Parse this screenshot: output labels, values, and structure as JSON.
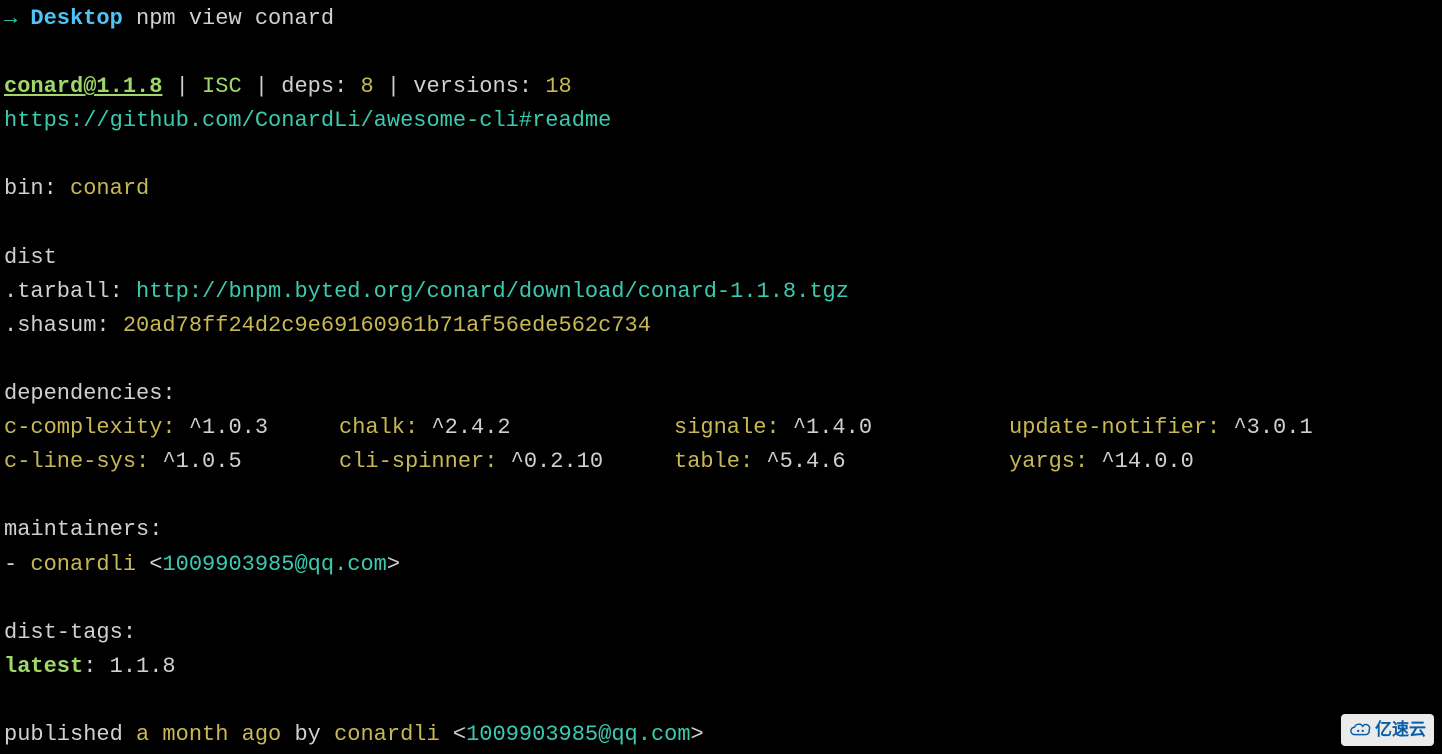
{
  "prompt": {
    "arrow": "→",
    "location": "Desktop",
    "command": "npm view conard"
  },
  "package": {
    "name": "conard",
    "at": "@",
    "version": "1.1.8",
    "license": "ISC",
    "deps_label": "deps:",
    "deps_count": "8",
    "versions_label": "versions:",
    "versions_count": "18",
    "url": "https://github.com/ConardLi/awesome-cli#readme"
  },
  "bin": {
    "label": "bin:",
    "value": "conard"
  },
  "dist": {
    "header": "dist",
    "tarball_label": ".tarball:",
    "tarball_url": "http://bnpm.byted.org/conard/download/conard-1.1.8.tgz",
    "shasum_label": ".shasum:",
    "shasum_value": "20ad78ff24d2c9e69160961b71af56ede562c734"
  },
  "dependencies": {
    "header": "dependencies:",
    "items": [
      {
        "name": "c-complexity:",
        "version": "^1.0.3"
      },
      {
        "name": "chalk:",
        "version": "^2.4.2"
      },
      {
        "name": "signale:",
        "version": "^1.4.0"
      },
      {
        "name": "update-notifier:",
        "version": "^3.0.1"
      },
      {
        "name": "c-line-sys:",
        "version": "^1.0.5"
      },
      {
        "name": "cli-spinner:",
        "version": "^0.2.10"
      },
      {
        "name": "table:",
        "version": "^5.4.6"
      },
      {
        "name": "yargs:",
        "version": "^14.0.0"
      }
    ]
  },
  "maintainers": {
    "header": "maintainers:",
    "prefix": "- ",
    "name": "conardli",
    "bracket_open": " <",
    "email": "1009903985@qq.com",
    "bracket_close": ">"
  },
  "dist_tags": {
    "header": "dist-tags:",
    "tag": "latest",
    "colon": ": ",
    "value": "1.1.8"
  },
  "published": {
    "prefix": "published ",
    "ago": "a month ago",
    "by": " by ",
    "author": "conardli",
    "bracket_open": " <",
    "email": "1009903985@qq.com",
    "bracket_close": ">"
  },
  "watermark": "亿速云"
}
